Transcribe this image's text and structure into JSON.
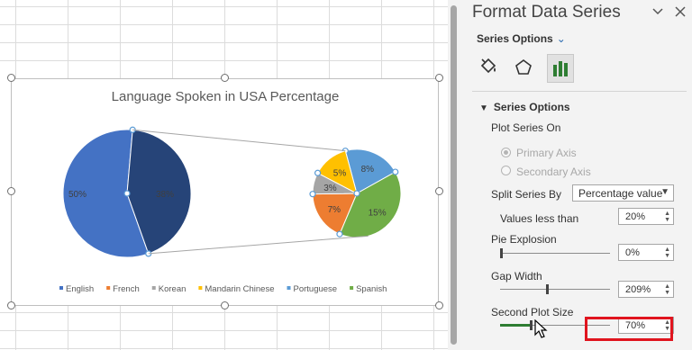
{
  "chart": {
    "title": "Language Spoken in USA Percentage",
    "legend": [
      "English",
      "French",
      "Korean",
      "Mandarin Chinese",
      "Portuguese",
      "Spanish"
    ],
    "primary_labels": [
      "50%",
      "38%"
    ],
    "secondary_labels": [
      "8%",
      "15%",
      "7%",
      "3%",
      "5%"
    ]
  },
  "chart_data": {
    "type": "pie",
    "title": "Language Spoken in USA Percentage",
    "categories": [
      "English",
      "French",
      "Korean",
      "Mandarin Chinese",
      "Portuguese",
      "Spanish"
    ],
    "values": [
      50,
      7,
      3,
      5,
      8,
      15
    ],
    "combined_slice_value": 38,
    "subtype": "pie-of-pie",
    "legend_position": "bottom",
    "colors": {
      "English": "#4472c4",
      "French": "#ed7d31",
      "Korean": "#a5a5a5",
      "Mandarin Chinese": "#ffc000",
      "Portuguese": "#5b9bd5",
      "Spanish": "#70ad47",
      "Other": "#264478"
    }
  },
  "pane": {
    "title": "Format Data Series",
    "series_options_label": "Series Options",
    "section_header": "Series Options",
    "plot_series_on": "Plot Series On",
    "primary_axis": "Primary Axis",
    "secondary_axis": "Secondary Axis",
    "split_series_by": "Split Series By",
    "split_value": "Percentage value",
    "values_less_than": "Values less than",
    "values_less_than_value": "20%",
    "pie_explosion": "Pie Explosion",
    "pie_explosion_value": "0%",
    "gap_width": "Gap Width",
    "gap_width_value": "209%",
    "gap_width_pos": 0.42,
    "second_plot_size": "Second Plot Size",
    "second_plot_size_value": "70%",
    "second_plot_size_pos": 0.27
  }
}
